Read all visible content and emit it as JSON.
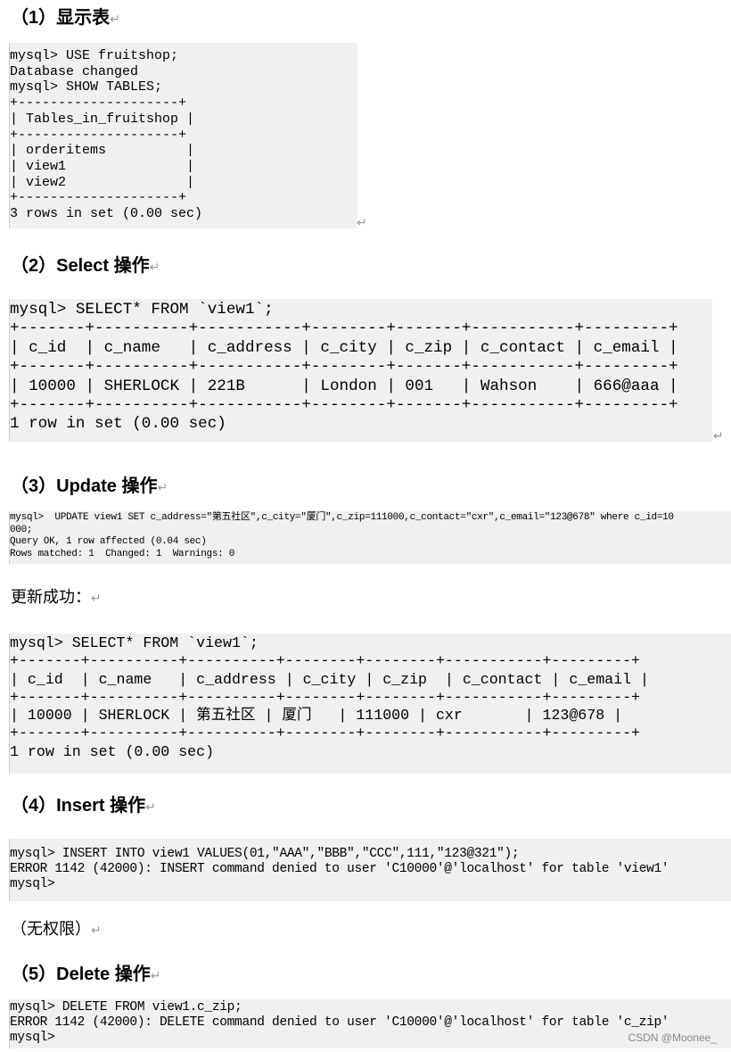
{
  "sections": [
    {
      "heading": "（1）显示表",
      "lines": [
        "mysql> USE fruitshop;",
        "Database changed",
        "mysql> SHOW TABLES;",
        "+--------------------+",
        "| Tables_in_fruitshop |",
        "+--------------------+",
        "| orderitems          |",
        "| view1               |",
        "| view2               |",
        "+--------------------+",
        "3 rows in set (0.00 sec)"
      ]
    },
    {
      "heading": "（2）Select 操作",
      "lines": [
        "mysql> SELECT* FROM `view1`;",
        "+-------+----------+-----------+--------+-------+-----------+---------+",
        "| c_id  | c_name   | c_address | c_city | c_zip | c_contact | c_email |",
        "+-------+----------+-----------+--------+-------+-----------+---------+",
        "| 10000 | SHERLOCK | 221B      | London | 001   | Wahson    | 666@aaa |",
        "+-------+----------+-----------+--------+-------+-----------+---------+",
        "1 row in set (0.00 sec)"
      ]
    },
    {
      "heading": "（3）Update 操作",
      "lines": [
        "mysql>  UPDATE view1 SET c_address=\"第五社区\",c_city=\"厦门\",c_zip=111000,c_contact=\"cxr\",c_email=\"123@678\" where c_id=10",
        "000;",
        "Query OK, 1 row affected (0.04 sec)",
        "Rows matched: 1  Changed: 1  Warnings: 0"
      ]
    },
    {
      "heading": "更新成功：",
      "lines": [
        "mysql> SELECT* FROM `view1`;",
        "+-------+----------+----------+--------+--------+-----------+---------+",
        "| c_id  | c_name   | c_address | c_city | c_zip  | c_contact | c_email |",
        "+-------+----------+----------+--------+--------+-----------+---------+",
        "| 10000 | SHERLOCK | 第五社区 | 厦门   | 111000 | cxr       | 123@678 |",
        "+-------+----------+----------+--------+--------+-----------+---------+",
        "1 row in set (0.00 sec)"
      ]
    },
    {
      "heading": "（4）Insert 操作",
      "lines": [
        "mysql> INSERT INTO view1 VALUES(01,\"AAA\",\"BBB\",\"CCC\",111,\"123@321\");",
        "ERROR 1142 (42000): INSERT command denied to user 'C10000'@'localhost' for table 'view1'",
        "mysql>"
      ]
    },
    {
      "heading": "（无权限）",
      "lines": []
    },
    {
      "heading": "（5）Delete 操作",
      "lines": [
        "mysql> DELETE FROM view1.c_zip;",
        "ERROR 1142 (42000): DELETE command denied to user 'C10000'@'localhost' for table 'c_zip'",
        "mysql>"
      ]
    }
  ],
  "return_mark": "↵",
  "watermark": "CSDN @Moonee_"
}
